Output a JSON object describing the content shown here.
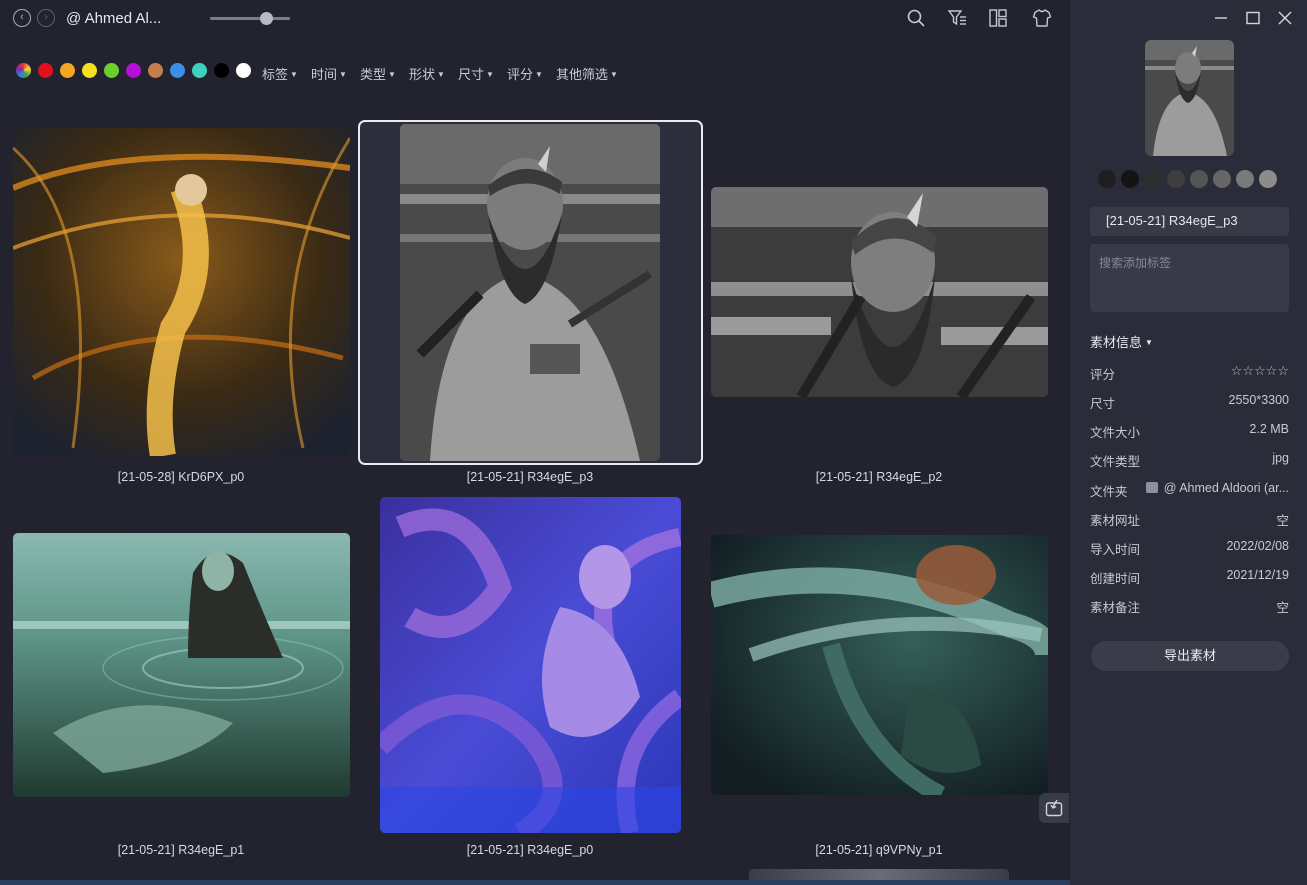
{
  "topbar": {
    "back_icon": "chevron-left-icon",
    "forward_icon": "chevron-right-icon",
    "folder_title": "@ Ahmed Al...",
    "zoom_level": 0.7,
    "tools": [
      "search-icon",
      "filter-icon",
      "layout-icon",
      "shirt-icon"
    ]
  },
  "filters": {
    "colors": [
      "rainbow",
      "#e0101e",
      "#f5a623",
      "#f4e01f",
      "#6bd12a",
      "#b40fd6",
      "#c77d4a",
      "#3b8fe6",
      "#3fd1c0",
      "#000000",
      "#ffffff"
    ],
    "items": [
      {
        "label": "标签"
      },
      {
        "label": "时间"
      },
      {
        "label": "类型"
      },
      {
        "label": "形状"
      },
      {
        "label": "尺寸"
      },
      {
        "label": "评分"
      },
      {
        "label": "其他筛选"
      }
    ]
  },
  "grid": {
    "items": [
      {
        "caption": "[21-05-28] KrD6PX_p0"
      },
      {
        "caption": "[21-05-21] R34egE_p3",
        "selected": true
      },
      {
        "caption": "[21-05-21] R34egE_p2"
      },
      {
        "caption": "[21-05-21] R34egE_p1"
      },
      {
        "caption": "[21-05-21] R34egE_p0"
      },
      {
        "caption": "[21-05-21] q9VPNy_p1"
      }
    ]
  },
  "sidebar": {
    "window": [
      "minimize-icon",
      "maximize-icon",
      "close-icon"
    ],
    "palette": [
      "#1f1f1f",
      "#141414",
      "#2e2e2e",
      "#3e3e3e",
      "#555555",
      "#666666",
      "#7a7a7a",
      "#8c8c8c"
    ],
    "name": "[21-05-21] R34egE_p3",
    "tag_placeholder": "搜索添加标签",
    "section_title": "素材信息",
    "info": {
      "rating_label": "评分",
      "rating_stars": "☆☆☆☆☆",
      "size_label": "尺寸",
      "size_value": "2550*3300",
      "filesize_label": "文件大小",
      "filesize_value": "2.2 MB",
      "filetype_label": "文件类型",
      "filetype_value": "jpg",
      "folder_label": "文件夹",
      "folder_value": "@ Ahmed Aldoori (ar...",
      "url_label": "素材网址",
      "url_value": "空",
      "import_label": "导入时间",
      "import_value": "2022/02/08",
      "created_label": "创建时间",
      "created_value": "2021/12/19",
      "note_label": "素材备注",
      "note_value": "空"
    },
    "export_label": "导出素材"
  }
}
